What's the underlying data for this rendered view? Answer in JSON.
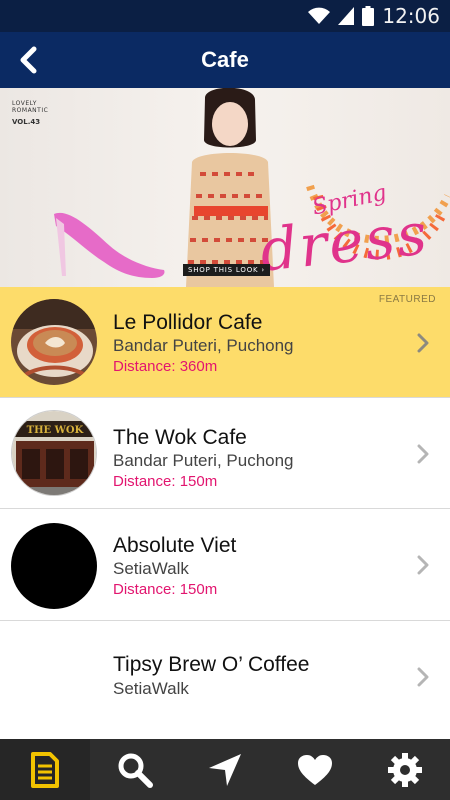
{
  "status_bar": {
    "time": "12:06"
  },
  "app_bar": {
    "title": "Cafe"
  },
  "banner": {
    "mag_label_line1": "LOVELY",
    "mag_label_line2": "ROMANTIC",
    "mag_vol": "VOL.43",
    "script_text": "Spring",
    "big_text": "dress",
    "shop_button": "SHOP THIS LOOK ›"
  },
  "cafes": [
    {
      "name": "Le Pollidor Cafe",
      "area": "Bandar Puteri, Puchong",
      "distance": "Distance: 360m",
      "featured": true,
      "featured_label": "FEATURED"
    },
    {
      "name": "The Wok Cafe",
      "area": "Bandar Puteri, Puchong",
      "distance": "Distance: 150m"
    },
    {
      "name": "Absolute Viet",
      "area": "SetiaWalk",
      "distance": "Distance: 150m"
    },
    {
      "name": "Tipsy Brew O’ Coffee",
      "area": "SetiaWalk",
      "distance": ""
    }
  ],
  "wok_sign": "THE WOK",
  "bottom_nav": {
    "active_tab": "list",
    "tabs": [
      "list-icon",
      "search-icon",
      "navigation-icon",
      "heart-icon",
      "gear-icon"
    ]
  },
  "colors": {
    "app_bar": "#0b2a63",
    "featured_row": "#fddc6a",
    "distance_text": "#e2156f",
    "active_tab_icon": "#f2c300"
  }
}
